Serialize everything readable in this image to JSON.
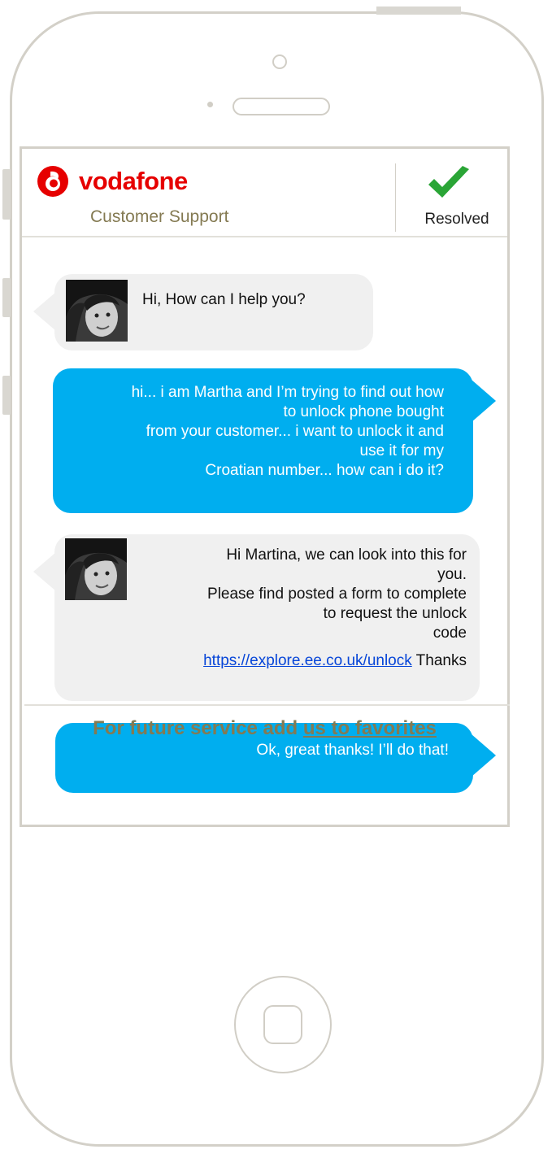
{
  "header": {
    "brand": "vodafone",
    "subtitle": "Customer Support",
    "status_label": "Resolved",
    "brand_color": "#e60000",
    "status_icon": "check-mark-icon",
    "status_color": "#2aa536"
  },
  "messages": [
    {
      "from": "agent",
      "text": "Hi, How can I help you?"
    },
    {
      "from": "user",
      "text": "hi... i am Martha and I’m trying to find out how\nto unlock phone bought\nfrom your customer... i want to unlock it and\nuse it for my\nCroatian number... how can i do it?"
    },
    {
      "from": "agent",
      "text": "Hi Martina, we can look into this for\nyou.\nPlease find posted a form to complete\nto request the unlock\ncode",
      "link": "https://explore.ee.co.uk/unlock",
      "after_link": " Thanks"
    },
    {
      "from": "user",
      "text": "Ok, great thanks! I’ll do that!"
    }
  ],
  "footer": {
    "prefix": "For future service add ",
    "link_text": "us to favorites"
  },
  "colors": {
    "agent_bubble": "#f0f0f0",
    "user_bubble": "#00aeef",
    "accent_text": "#847a52"
  }
}
